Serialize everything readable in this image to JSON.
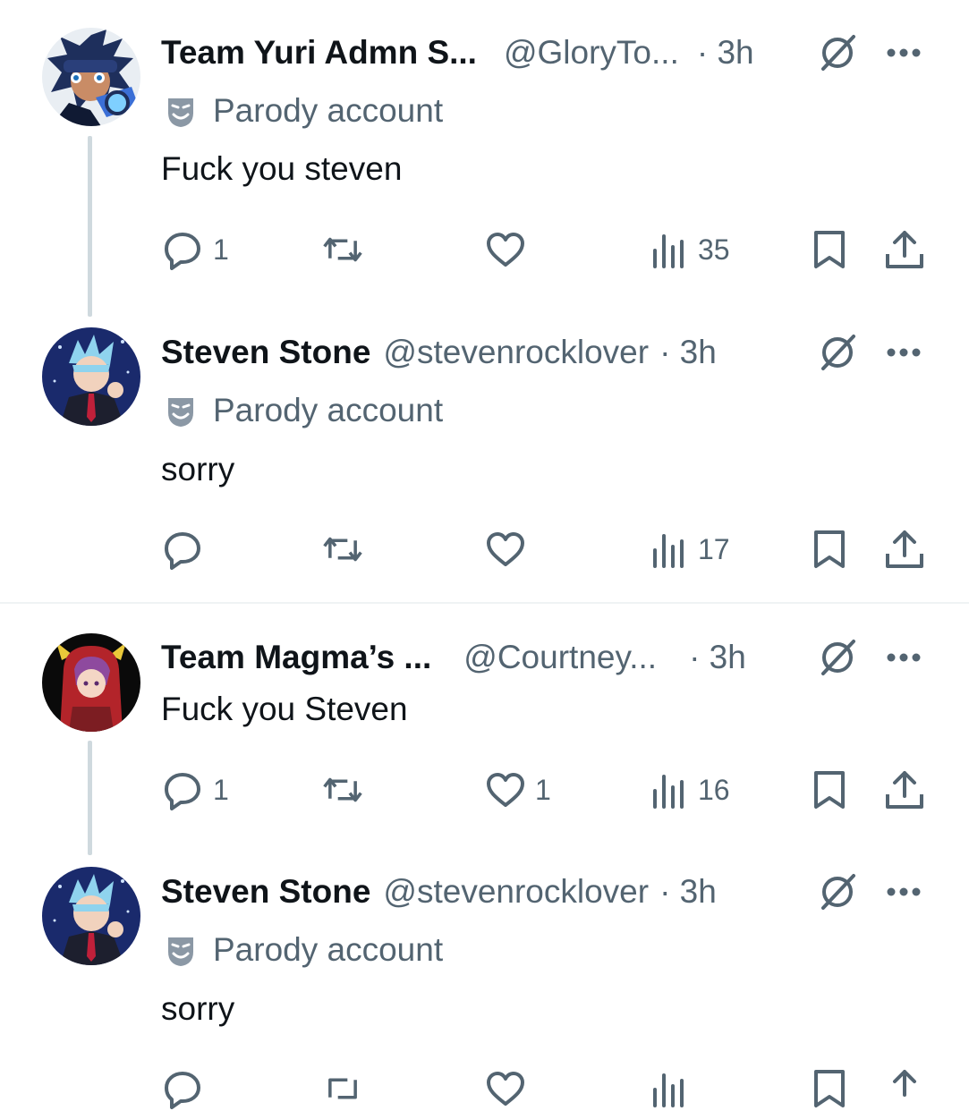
{
  "tweets": [
    {
      "name": "Team Yuri Admn S...",
      "handle": "@GloryTo...",
      "time": "· 3h",
      "label": "Parody account",
      "text": "Fuck you steven",
      "replies": "1",
      "retweets": "",
      "likes": "",
      "views": "35"
    },
    {
      "name": "Steven Stone",
      "handle": "@stevenrocklover",
      "time": "· 3h",
      "label": "Parody account",
      "text": "sorry",
      "replies": "",
      "retweets": "",
      "likes": "",
      "views": "17"
    },
    {
      "name": "Team Magma’s ...",
      "handle": "@Courtney...",
      "time": "· 3h",
      "label": "",
      "text": "Fuck you Steven",
      "replies": "1",
      "retweets": "",
      "likes": "1",
      "views": "16"
    },
    {
      "name": "Steven Stone",
      "handle": "@stevenrocklover",
      "time": "· 3h",
      "label": "Parody account",
      "text": "sorry",
      "replies": "",
      "retweets": "",
      "likes": "",
      "views": ""
    }
  ],
  "icons": {
    "reply": "reply-icon",
    "retweet": "retweet-icon",
    "like": "like-icon",
    "views": "views-icon",
    "bookmark": "bookmark-icon",
    "share": "share-icon",
    "grok": "grok-icon",
    "more": "more-icon",
    "parody": "parody-mask-icon"
  },
  "colors": {
    "text": "#0f1419",
    "secondary": "#536471",
    "thread_line": "#cfd9de",
    "divider": "#eff3f4"
  }
}
